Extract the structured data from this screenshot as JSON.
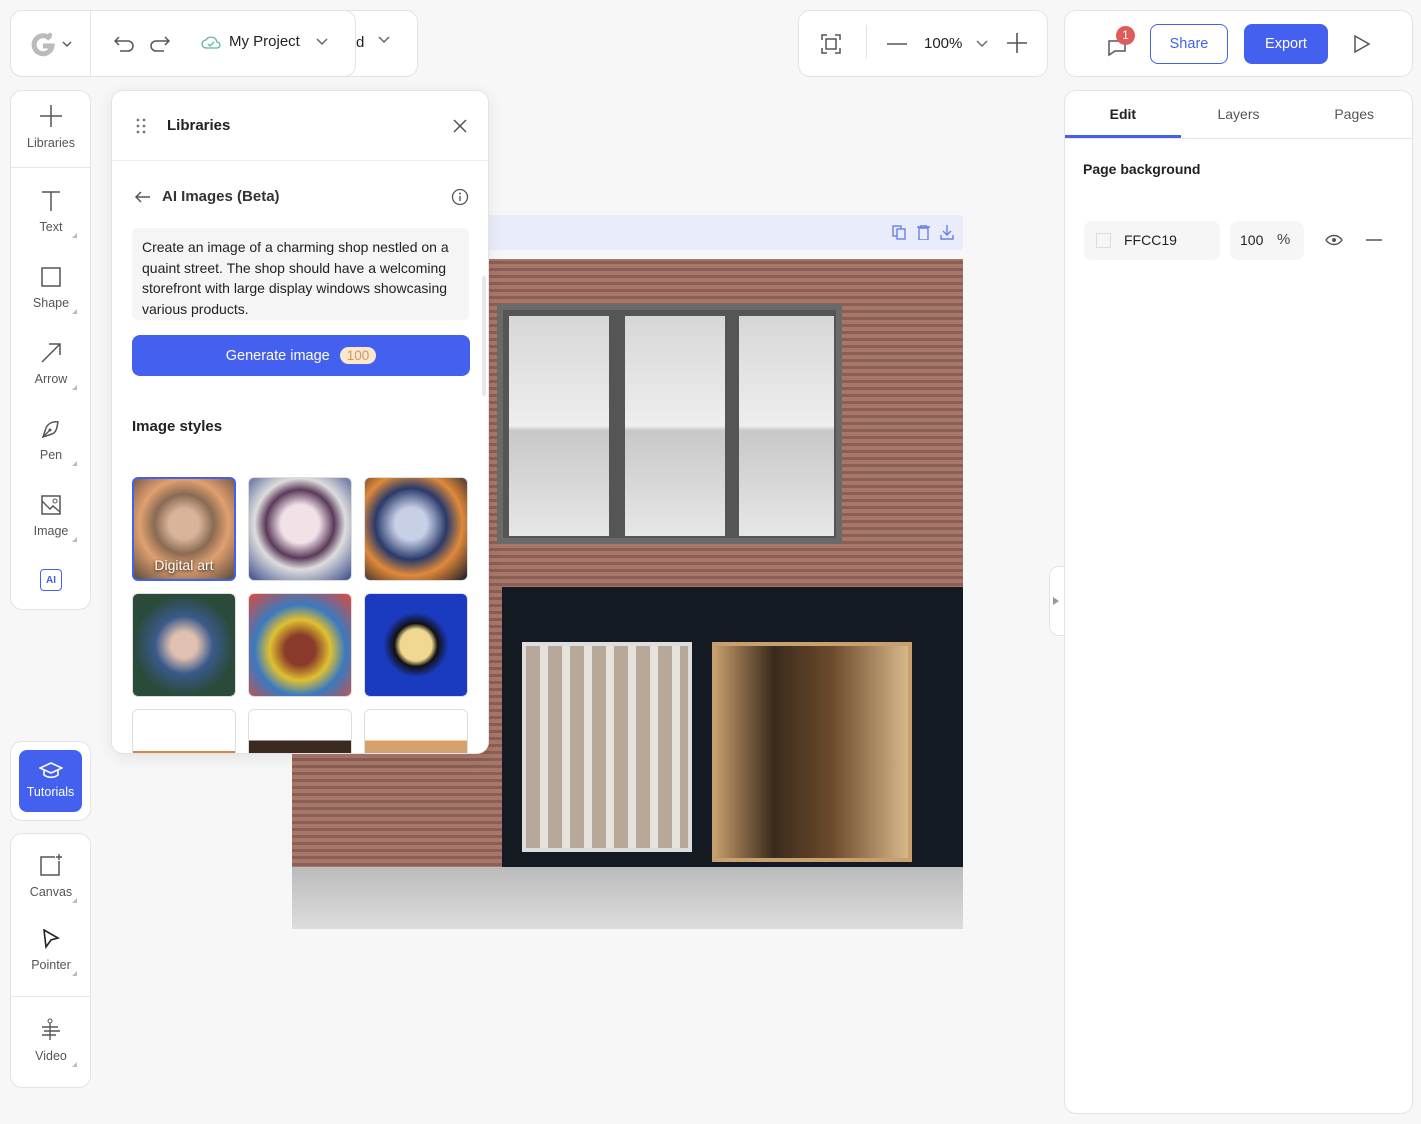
{
  "topbar": {
    "project_name": "My Project",
    "truncated_label": "d"
  },
  "zoom": {
    "level": "100%"
  },
  "actions": {
    "notification_count": "1",
    "share_label": "Share",
    "export_label": "Export"
  },
  "left_toolbar": {
    "items": [
      {
        "label": "Libraries"
      },
      {
        "label": "Text"
      },
      {
        "label": "Shape"
      },
      {
        "label": "Arrow"
      },
      {
        "label": "Pen"
      },
      {
        "label": "Image"
      }
    ],
    "ai_label": "AI"
  },
  "tutorials": {
    "label": "Tutorials"
  },
  "bottom_toolbar": {
    "items": [
      {
        "label": "Canvas"
      },
      {
        "label": "Pointer"
      },
      {
        "label": "Video"
      }
    ]
  },
  "libraries": {
    "title": "Libraries",
    "subtitle": "AI Images (Beta)",
    "prompt": "Create an image of a charming shop nestled on a quaint street. The shop should have a welcoming storefront with large display windows showcasing various products.",
    "generate_label": "Generate image",
    "credits": "100",
    "styles_title": "Image styles",
    "styles": [
      {
        "label": "Digital art",
        "selected": true
      },
      {
        "label": ""
      },
      {
        "label": ""
      },
      {
        "label": ""
      },
      {
        "label": ""
      },
      {
        "label": ""
      },
      {
        "label": ""
      },
      {
        "label": ""
      },
      {
        "label": ""
      }
    ]
  },
  "right_panel": {
    "tabs": [
      {
        "label": "Edit",
        "active": true
      },
      {
        "label": "Layers"
      },
      {
        "label": "Pages"
      }
    ],
    "section_title": "Page background",
    "color_value": "FFCC19",
    "opacity_value": "100",
    "opacity_unit": "%"
  },
  "colors": {
    "accent": "#4361ee",
    "badge": "#e05a5a",
    "credits_bg": "#fbe7cc"
  }
}
